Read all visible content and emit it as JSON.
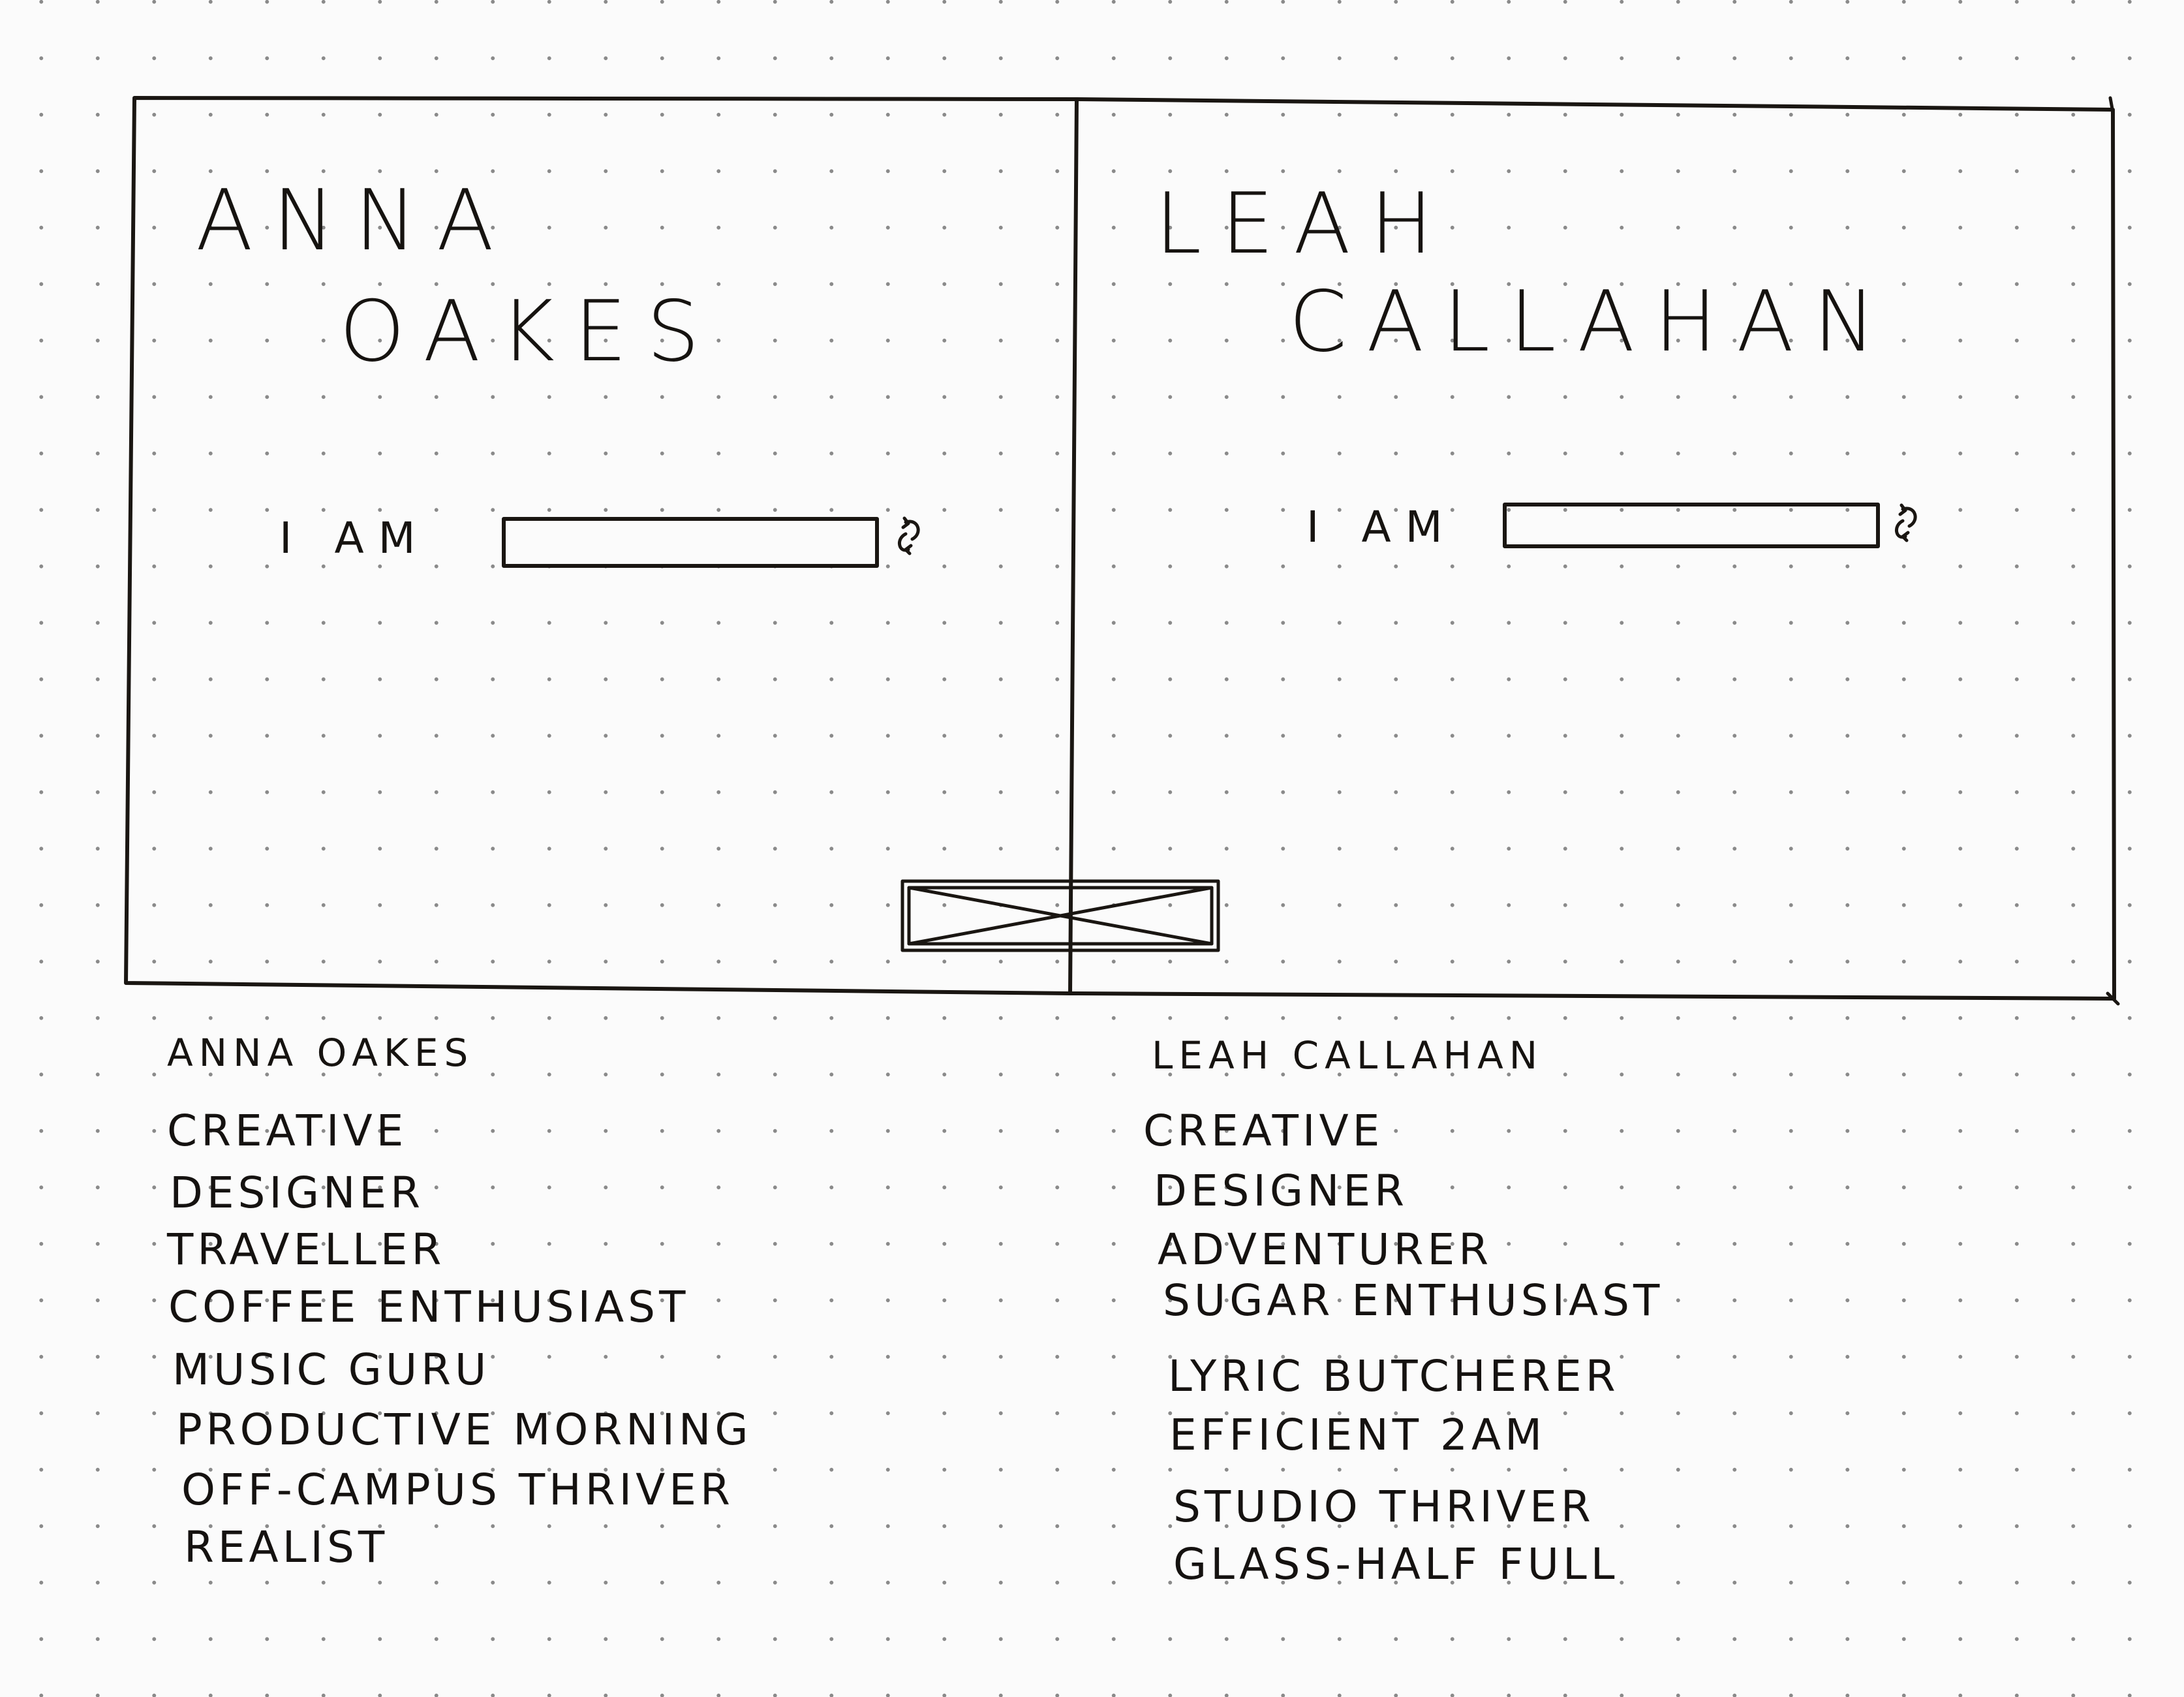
{
  "left_panel": {
    "first_name": "ANNA",
    "last_name": "OAKES",
    "prompt": "I AM",
    "input_value": "",
    "refresh_icon": "refresh-icon"
  },
  "right_panel": {
    "first_name": "LEAH",
    "last_name": "CALLAHAN",
    "prompt": "I AM",
    "input_value": "",
    "refresh_icon": "refresh-icon"
  },
  "center_placeholder": "image-placeholder",
  "left_list": {
    "title": "ANNA OAKES",
    "traits": [
      "CREATIVE",
      "DESIGNER",
      "TRAVELLER",
      "COFFEE ENTHUSIAST",
      "MUSIC GURU",
      "PRODUCTIVE MORNING",
      "OFF-CAMPUS THRIVER",
      "REALIST"
    ]
  },
  "right_list": {
    "title": "LEAH CALLAHAN",
    "traits": [
      "CREATIVE",
      "DESIGNER",
      "ADVENTURER",
      "SUGAR ENTHUSIAST",
      "LYRIC BUTCHERER",
      "EFFICIENT 2AM",
      "STUDIO THRIVER",
      "GLASS-HALF FULL"
    ]
  }
}
